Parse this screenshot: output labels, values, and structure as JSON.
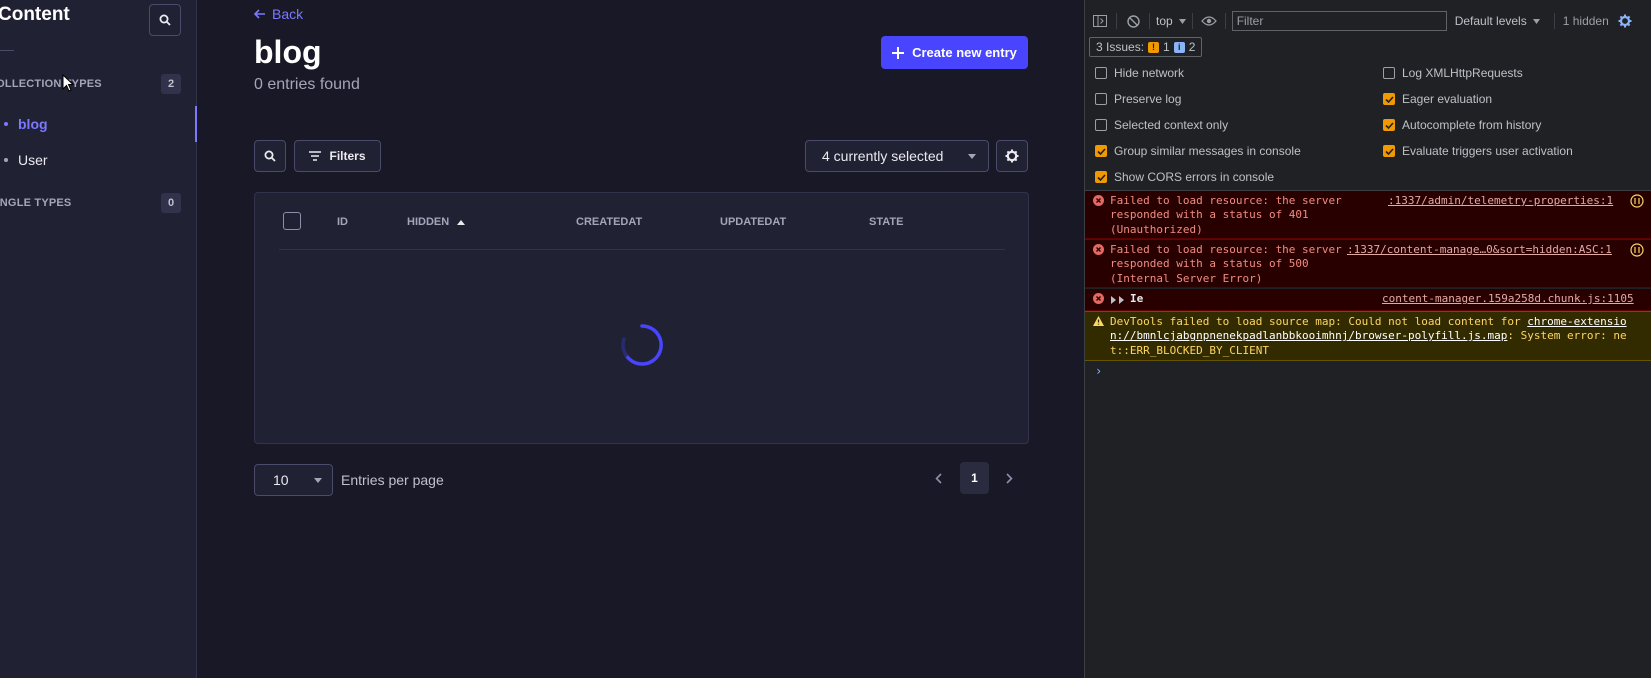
{
  "nav": {
    "title": "Content",
    "sections": [
      {
        "label": "COLLECTION TYPES",
        "count": "2"
      },
      {
        "label": "SINGLE TYPES",
        "count": "0"
      }
    ],
    "items": [
      {
        "label": "blog"
      },
      {
        "label": "User"
      }
    ]
  },
  "main": {
    "back_label": "Back",
    "title": "blog",
    "subtitle": "0 entries found",
    "create_label": "Create new entry",
    "filters_label": "Filters",
    "columns_select": "4 currently selected",
    "columns": [
      "ID",
      "HIDDEN",
      "CREATEDAT",
      "UPDATEDAT",
      "STATE"
    ],
    "sort_column": "HIDDEN",
    "per_page_value": "10",
    "per_page_label": "Entries per page",
    "current_page": "1"
  },
  "devtools": {
    "context": "top",
    "filter_placeholder": "Filter",
    "levels": "Default levels",
    "hidden": "1 hidden",
    "issues_label": "3 Issues:",
    "issues_warn": "1",
    "issues_info": "2",
    "settings_left": [
      {
        "label": "Hide network",
        "checked": false
      },
      {
        "label": "Preserve log",
        "checked": false
      },
      {
        "label": "Selected context only",
        "checked": false
      },
      {
        "label": "Group similar messages in console",
        "checked": true
      },
      {
        "label": "Show CORS errors in console",
        "checked": true
      }
    ],
    "settings_right": [
      {
        "label": "Log XMLHttpRequests",
        "checked": false
      },
      {
        "label": "Eager evaluation",
        "checked": true
      },
      {
        "label": "Autocomplete from history",
        "checked": true
      },
      {
        "label": "Evaluate triggers user activation",
        "checked": true
      }
    ],
    "messages": {
      "err1_text": "Failed to load resource: the server\nresponded with a status of 401\n(Unauthorized)",
      "err1_link": ":1337/admin/telemetry-properties:1",
      "err2_text": "Failed to load resource: the server\nresponded with a status of 500\n(Internal Server Error)",
      "err2_link": ":1337/content-manage…0&sort=hidden:ASC:1",
      "err3_text": "Ie",
      "err3_link": "content-manager.159a258d.chunk.js:1105",
      "warn_prefix": "DevTools failed to load source map: Could not load content for ",
      "warn_link": "chrome-extension://bmnlcjabgnpnenekpadlanbbkooimhnj/browser-polyfill.js.map",
      "warn_suffix": ": System error: net::ERR_BLOCKED_BY_CLIENT"
    },
    "prompt": "›"
  },
  "colors": {
    "accent": "#4945ff",
    "accent_text": "#7b79ff",
    "error": "#f28b82",
    "warning": "#fdd663",
    "checkbox_on": "#f29900"
  }
}
